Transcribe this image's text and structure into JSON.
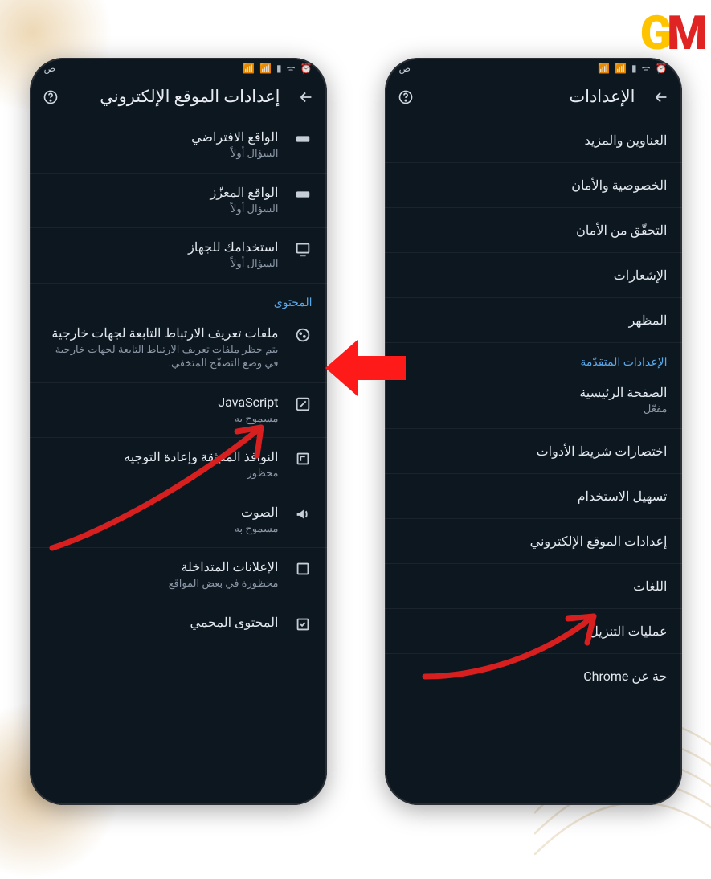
{
  "logo": {
    "g": "G",
    "m": "M"
  },
  "status": {
    "time": "ص",
    "icons": [
      "📶",
      "📶",
      "📡",
      "🔋",
      "⏰"
    ]
  },
  "phone_right": {
    "title": "الإعدادات",
    "items": [
      {
        "title": "العناوين والمزيد"
      },
      {
        "title": "الخصوصية والأمان"
      },
      {
        "title": "التحقّق من الأمان"
      },
      {
        "title": "الإشعارات"
      },
      {
        "title": "المظهر"
      }
    ],
    "section": "الإعدادات المتقدّمة",
    "advanced": [
      {
        "title": "الصفحة الرئيسية",
        "sub": "مفعّل"
      },
      {
        "title": "اختصارات شريط الأدوات"
      },
      {
        "title": "تسهيل الاستخدام"
      },
      {
        "title": "إعدادات الموقع الإلكتروني"
      },
      {
        "title": "اللغات"
      },
      {
        "title": "عمليات التنزيل"
      },
      {
        "title": "حة عن Chrome"
      }
    ]
  },
  "phone_left": {
    "title": "إعدادات الموقع الإلكتروني",
    "items": [
      {
        "icon": "vr",
        "title": "الواقع الافتراضي",
        "sub": "السؤال أولاً"
      },
      {
        "icon": "ar",
        "title": "الواقع المعزّز",
        "sub": "السؤال أولاً"
      },
      {
        "icon": "device",
        "title": "استخدامك للجهاز",
        "sub": "السؤال أولاً"
      }
    ],
    "section": "المحتوى",
    "content": [
      {
        "icon": "cookie",
        "title": "ملفات تعريف الارتباط التابعة لجهات خارجية",
        "sub": "يتم حظر ملفات تعريف الارتباط التابعة لجهات خارجية في وضع التصفّح المتخفي."
      },
      {
        "icon": "js",
        "title": "JavaScript",
        "sub": "مسموح به"
      },
      {
        "icon": "popup",
        "title": "النوافذ المنبثقة وإعادة التوجيه",
        "sub": "محظور"
      },
      {
        "icon": "sound",
        "title": "الصوت",
        "sub": "مسموح به"
      },
      {
        "icon": "ads",
        "title": "الإعلانات المتداخلة",
        "sub": "محظورة في بعض المواقع"
      },
      {
        "icon": "protected",
        "title": "المحتوى المحمي",
        "sub": ""
      }
    ]
  }
}
